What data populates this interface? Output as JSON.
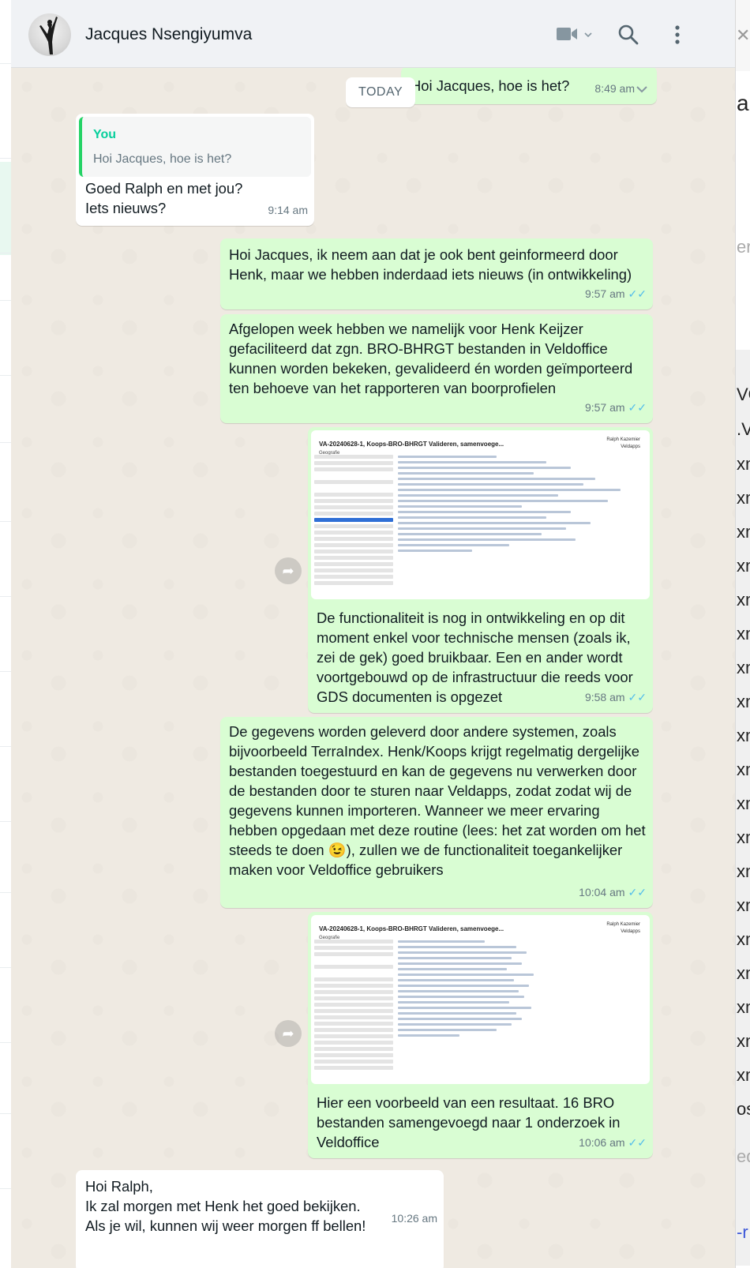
{
  "header": {
    "contact_name": "Jacques Nsengiyumva",
    "icons": [
      "video-call-icon",
      "chevron-down-icon",
      "search-icon",
      "menu-icon"
    ]
  },
  "date_divider": "TODAY",
  "colors": {
    "outgoing": "#d9fdd3",
    "incoming": "#ffffff",
    "read_ticks": "#53bdeb",
    "quote_bar": "#25d366",
    "quote_name": "#06cf9c"
  },
  "messages": [
    {
      "dir": "out",
      "text": "Hoi Jacques, hoe is het?",
      "time": "8:49 am"
    },
    {
      "dir": "in",
      "quote_name": "You",
      "quote_text": "Hoi Jacques, hoe is het?",
      "text": "Goed Ralph en met jou?\nIets nieuws?",
      "time": "9:14 am"
    },
    {
      "dir": "out",
      "text": "Hoi Jacques, ik neem aan dat je ook bent geinformeerd door Henk, maar we hebben inderdaad iets nieuws (in ontwikkeling)",
      "time": "9:57 am"
    },
    {
      "dir": "out",
      "text": "Afgelopen week hebben we namelijk voor Henk Keijzer gefaciliteerd dat zgn. BRO-BHRGT bestanden in Veldoffice kunnen worden bekeken, gevalideerd én worden geïmporteerd ten behoeve van het rapporteren van boorprofielen",
      "time": "9:57 am"
    },
    {
      "dir": "out",
      "image": {
        "title": "VA-20240628-1, Koops-BRO-BHRGT Valideren, samenvoege...",
        "sub": "Geografie",
        "user": "Ralph Kazemier",
        "org": "Veldapps"
      },
      "text": "De functionaliteit is nog in ontwikkeling en op dit moment enkel voor technische mensen (zoals ik, zei de gek) goed bruikbaar. Een en ander wordt voortgebouwd op de infrastructuur die reeds voor GDS documenten is opgezet",
      "time": "9:58 am"
    },
    {
      "dir": "out",
      "text": "De gegevens worden geleverd door andere systemen, zoals bijvoorbeeld TerraIndex. Henk/Koops krijgt regelmatig dergelijke bestanden toegestuurd en kan de gegevens nu verwerken door de bestanden door te sturen naar Veldapps, zodat zodat wij de gegevens kunnen importeren. Wanneer we meer ervaring hebben opgedaan met deze routine (lees: het zat worden om het steeds te doen 😉), zullen we de functionaliteit toegankelijker maken voor Veldoffice gebruikers",
      "time": "10:04 am"
    },
    {
      "dir": "out",
      "image": {
        "title": "VA-20240628-1, Koops-BRO-BHRGT Valideren, samenvoege...",
        "sub": "Geografie",
        "user": "Ralph Kazemier",
        "org": "Veldapps"
      },
      "text": "Hier een voorbeeld van een resultaat. 16 BRO bestanden samengevoegd naar 1 onderzoek in Veldoffice",
      "time": "10:06 am"
    },
    {
      "dir": "in",
      "text": "Hoi Ralph,\nIk zal morgen met Henk het goed bekijken.\nAls je wil, kunnen wij weer morgen ff bellen!",
      "time": "10:26 am"
    }
  ],
  "right_panel_fragments": [
    "ar",
    "er",
    "VO",
    ".V",
    "xm",
    "xm",
    "xm",
    "xm",
    "xm",
    "xm",
    "xm",
    "xm",
    "xm",
    "xm",
    "xm",
    "xm",
    "xm",
    "xm",
    "xm",
    "xm",
    "xm",
    "xm",
    "xm",
    "os",
    "ed",
    "-r"
  ]
}
